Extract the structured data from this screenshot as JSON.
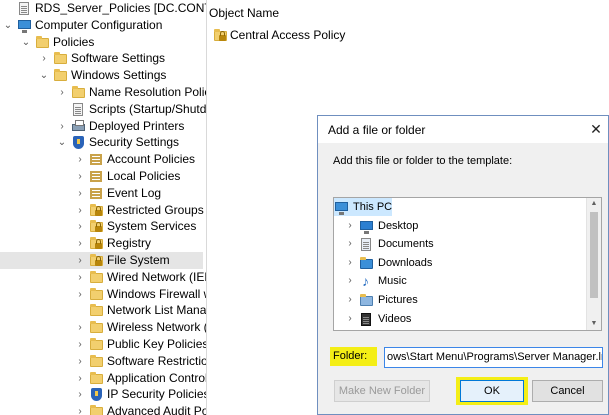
{
  "tree": {
    "items": [
      {
        "label": "RDS_Server_Policies [DC.CONTOSO.CO",
        "icon": "gpo-icon",
        "indent": 0,
        "expander": ""
      },
      {
        "label": "Computer Configuration",
        "icon": "computer-icon",
        "indent": 0,
        "expander": "open"
      },
      {
        "label": "Policies",
        "icon": "folder-icon",
        "indent": 1,
        "expander": "open"
      },
      {
        "label": "Software Settings",
        "icon": "folder-icon",
        "indent": 2,
        "expander": "closed"
      },
      {
        "label": "Windows Settings",
        "icon": "folder-icon",
        "indent": 2,
        "expander": "open"
      },
      {
        "label": "Name Resolution Policy",
        "icon": "folder-icon",
        "indent": 3,
        "expander": "closed"
      },
      {
        "label": "Scripts (Startup/Shutdo",
        "icon": "document-icon",
        "indent": 3,
        "expander": ""
      },
      {
        "label": "Deployed Printers",
        "icon": "printer-icon",
        "indent": 3,
        "expander": "closed"
      },
      {
        "label": "Security Settings",
        "icon": "security-icon",
        "indent": 3,
        "expander": "open"
      },
      {
        "label": "Account Policies",
        "icon": "policy-icon",
        "indent": 4,
        "expander": "closed"
      },
      {
        "label": "Local Policies",
        "icon": "policy-icon",
        "indent": 4,
        "expander": "closed"
      },
      {
        "label": "Event Log",
        "icon": "policy-icon",
        "indent": 4,
        "expander": "closed"
      },
      {
        "label": "Restricted Groups",
        "icon": "locked-folder-icon",
        "indent": 4,
        "expander": "closed"
      },
      {
        "label": "System Services",
        "icon": "locked-folder-icon",
        "indent": 4,
        "expander": "closed"
      },
      {
        "label": "Registry",
        "icon": "locked-folder-icon",
        "indent": 4,
        "expander": "closed"
      },
      {
        "label": "File System",
        "icon": "locked-folder-icon",
        "indent": 4,
        "expander": "closed",
        "selected": true
      },
      {
        "label": "Wired Network (IEEE",
        "icon": "folder-icon",
        "indent": 4,
        "expander": "closed"
      },
      {
        "label": "Windows Firewall w",
        "icon": "folder-icon",
        "indent": 4,
        "expander": "closed"
      },
      {
        "label": "Network List Manag",
        "icon": "folder-icon",
        "indent": 4,
        "expander": ""
      },
      {
        "label": "Wireless Network (II",
        "icon": "folder-icon",
        "indent": 4,
        "expander": "closed"
      },
      {
        "label": "Public Key Policies",
        "icon": "folder-icon",
        "indent": 4,
        "expander": "closed"
      },
      {
        "label": "Software Restriction",
        "icon": "folder-icon",
        "indent": 4,
        "expander": "closed"
      },
      {
        "label": "Application Control",
        "icon": "folder-icon",
        "indent": 4,
        "expander": "closed"
      },
      {
        "label": "IP Security Policies",
        "icon": "security-icon",
        "indent": 4,
        "expander": "closed"
      },
      {
        "label": "Advanced Audit Po",
        "icon": "folder-icon",
        "indent": 4,
        "expander": "closed"
      }
    ]
  },
  "content": {
    "column_header": "Object Name",
    "items": [
      {
        "label": "Central Access Policy",
        "icon": "locked-folder-icon"
      }
    ]
  },
  "dialog": {
    "title": "Add a file or folder",
    "close_glyph": "✕",
    "prompt": "Add this file or folder to the template:",
    "folders": [
      {
        "label": "This PC",
        "icon": "computer-icon",
        "expander": "open",
        "selected": true,
        "indent": 0
      },
      {
        "label": "Desktop",
        "icon": "desktop-icon",
        "expander": "closed",
        "indent": 1
      },
      {
        "label": "Documents",
        "icon": "documents-icon",
        "expander": "closed",
        "indent": 1
      },
      {
        "label": "Downloads",
        "icon": "downloads-icon",
        "expander": "closed",
        "indent": 1
      },
      {
        "label": "Music",
        "icon": "music-icon",
        "expander": "closed",
        "indent": 1
      },
      {
        "label": "Pictures",
        "icon": "pictures-icon",
        "expander": "closed",
        "indent": 1
      },
      {
        "label": "Videos",
        "icon": "videos-icon",
        "expander": "closed",
        "indent": 1
      }
    ],
    "folder_label": "Folder:",
    "folder_value": "ows\\Start Menu\\Programs\\Server Manager.lnk",
    "make_new_folder_label": "Make New Folder",
    "ok_label": "OK",
    "cancel_label": "Cancel"
  },
  "colors": {
    "highlight": "#f4ee16",
    "selection": "#cce8ff",
    "folder": "#f2cf6e"
  }
}
